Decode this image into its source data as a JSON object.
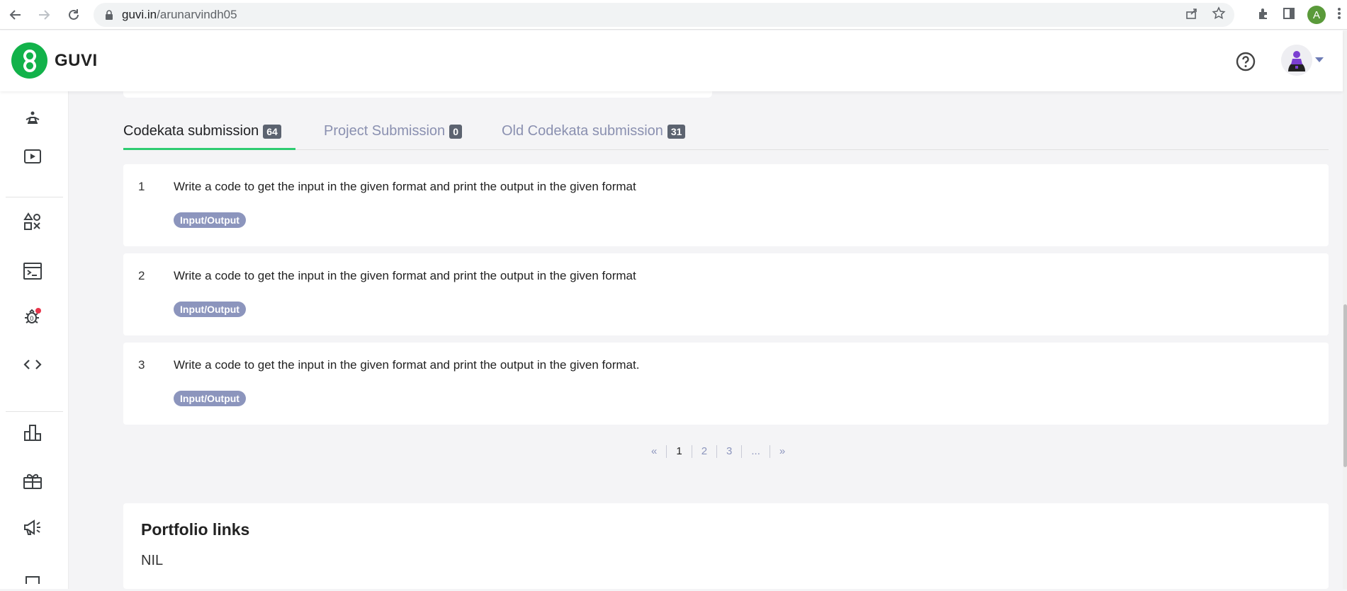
{
  "browser": {
    "url_host": "guvi.in",
    "url_path": "/arunarvindh05",
    "profile_initial": "A"
  },
  "header": {
    "logo_text": "GUVI"
  },
  "sidebar": {
    "items": [
      {
        "icon": "yoga-icon"
      },
      {
        "icon": "video-play-icon"
      },
      {
        "icon": "shapes-icon"
      },
      {
        "icon": "terminal-icon"
      },
      {
        "icon": "bug-icon"
      },
      {
        "icon": "code-icon"
      },
      {
        "icon": "leaderboard-icon"
      },
      {
        "icon": "gift-icon"
      },
      {
        "icon": "megaphone-icon"
      }
    ]
  },
  "tabs": [
    {
      "label": "Codekata submission",
      "count": "64",
      "active": true
    },
    {
      "label": "Project Submission",
      "count": "0",
      "active": false
    },
    {
      "label": "Old Codekata submission",
      "count": "31",
      "active": false
    }
  ],
  "submissions": [
    {
      "num": "1",
      "title": "Write a code to get the input in the given format and print the output in the given format",
      "tag": "Input/Output"
    },
    {
      "num": "2",
      "title": "Write a code to get the input in the given format and print the output in the given format",
      "tag": "Input/Output"
    },
    {
      "num": "3",
      "title": "Write a code to get the input in the given format and print the output in the given format.",
      "tag": "Input/Output"
    }
  ],
  "pagination": {
    "prev": "«",
    "pages": [
      "1",
      "2",
      "3",
      "..."
    ],
    "current": "1",
    "next": "»"
  },
  "portfolio": {
    "heading": "Portfolio links",
    "value": "NIL"
  },
  "colors": {
    "brand_green": "#12b24a",
    "tab_underline": "#2ecc71",
    "tag_bg": "#8c95bd",
    "inactive_tab": "#8a90b0"
  }
}
